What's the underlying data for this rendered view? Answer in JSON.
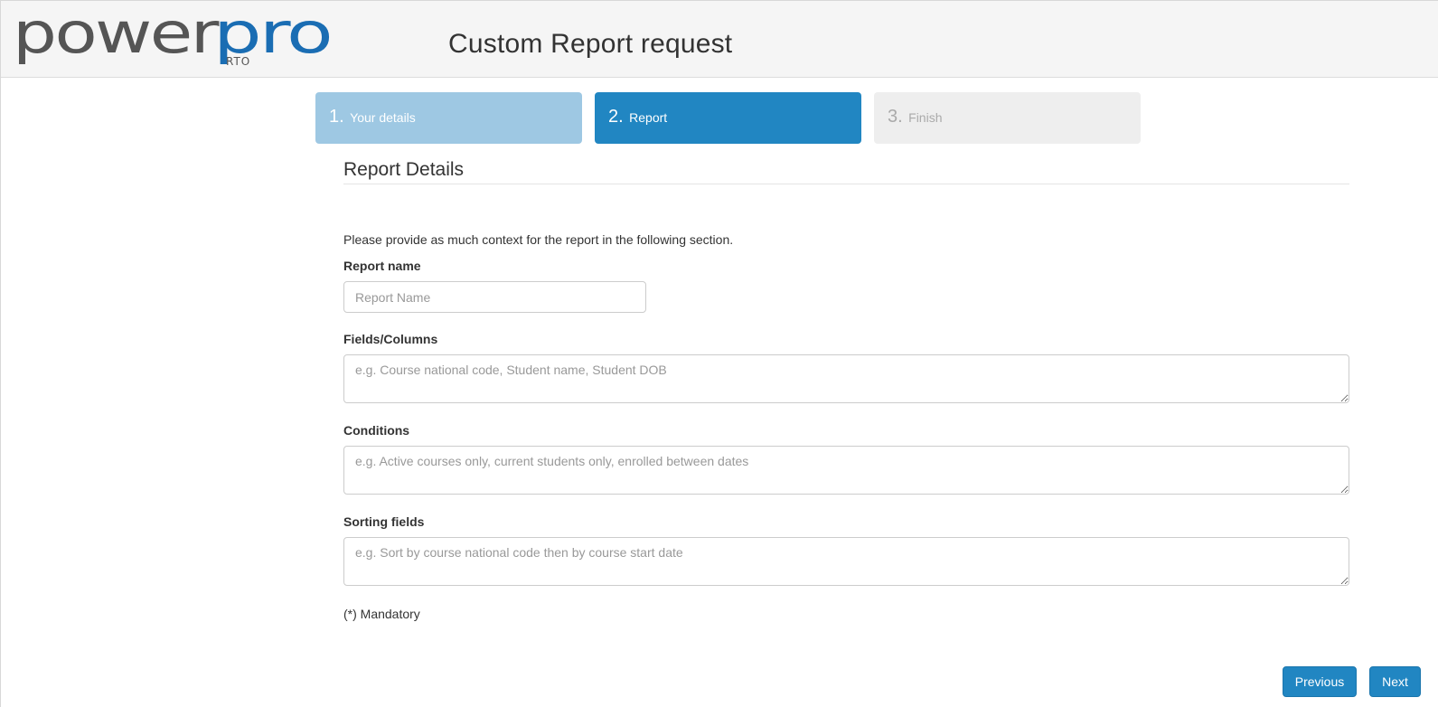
{
  "brand": {
    "logo_word_dark": "power",
    "logo_word_blue": "pro",
    "logo_sub": "RTO",
    "color_dark": "#555555",
    "color_blue": "#1a6db3"
  },
  "header": {
    "title": "Custom Report request"
  },
  "steps": [
    {
      "number": "1.",
      "label": "Your details",
      "state": "completed"
    },
    {
      "number": "2.",
      "label": "Report",
      "state": "active"
    },
    {
      "number": "3.",
      "label": "Finish",
      "state": "pending"
    }
  ],
  "form": {
    "section_title": "Report Details",
    "intro": "Please provide as much context for the report in the following section.",
    "report_name": {
      "label": "Report name",
      "placeholder": "Report Name",
      "value": ""
    },
    "fields_columns": {
      "label": "Fields/Columns",
      "placeholder": "e.g. Course national code, Student name, Student DOB",
      "value": ""
    },
    "conditions": {
      "label": "Conditions",
      "placeholder": "e.g. Active courses only, current students only, enrolled between dates",
      "value": ""
    },
    "sorting_fields": {
      "label": "Sorting fields",
      "placeholder": "e.g. Sort by course national code then by course start date",
      "value": ""
    },
    "mandatory_note": "(*) Mandatory"
  },
  "buttons": {
    "previous": "Previous",
    "next": "Next"
  },
  "colors": {
    "accent": "#2186c2",
    "step_completed": "#9ec8e3",
    "step_pending": "#eeeeee",
    "header_bg": "#f5f5f5"
  }
}
